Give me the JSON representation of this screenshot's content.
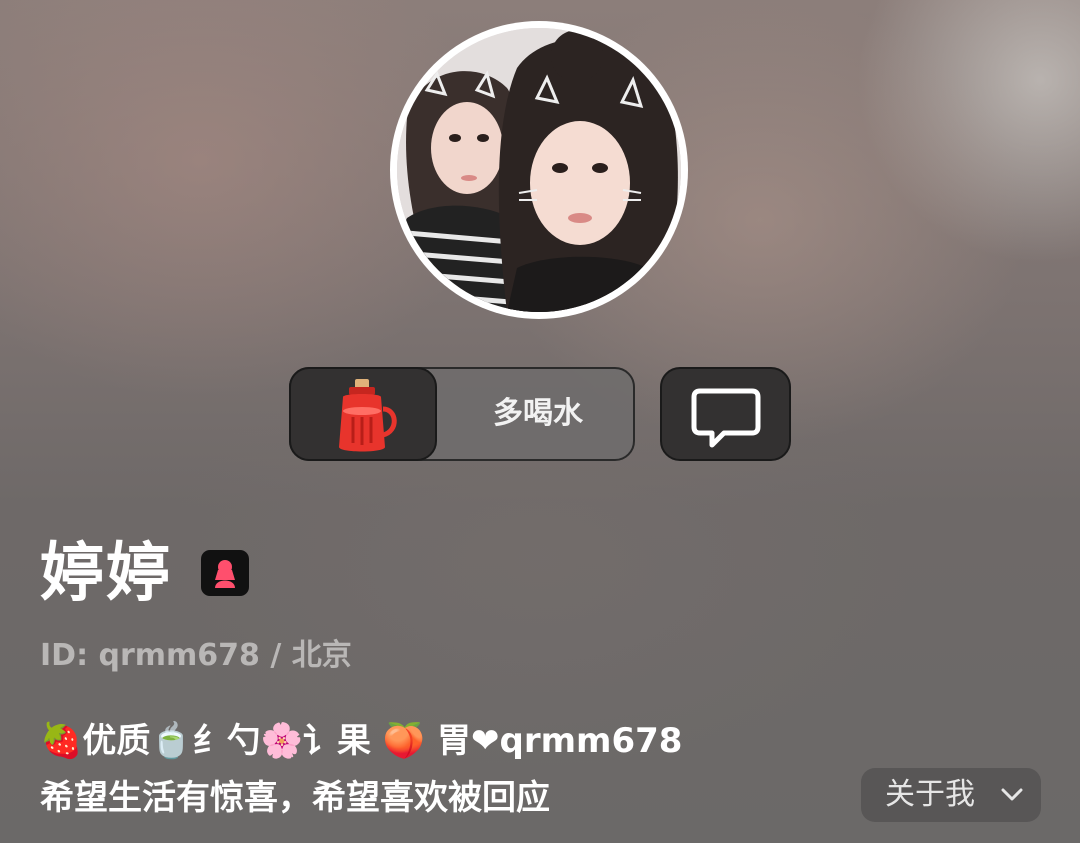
{
  "profile": {
    "name": "婷婷",
    "id_line": "ID: qrmm678 / 北京",
    "bio_line_1": "🍓优质🍵纟勺🌸讠果 🍑 胃❤qrmm678",
    "bio_line_2": "希望生活有惊喜，希望喜欢被回应"
  },
  "actions": {
    "gift_label": "多喝水",
    "about_label": "关于我"
  },
  "icons": {
    "gift": "thermos-bottle-icon",
    "chat": "speech-bubble-icon",
    "gender": "female-user-icon",
    "about": "chevron-down-icon"
  },
  "colors": {
    "thermos_red": "#e8342c",
    "gender_badge_accent": "#ff4f6d"
  }
}
